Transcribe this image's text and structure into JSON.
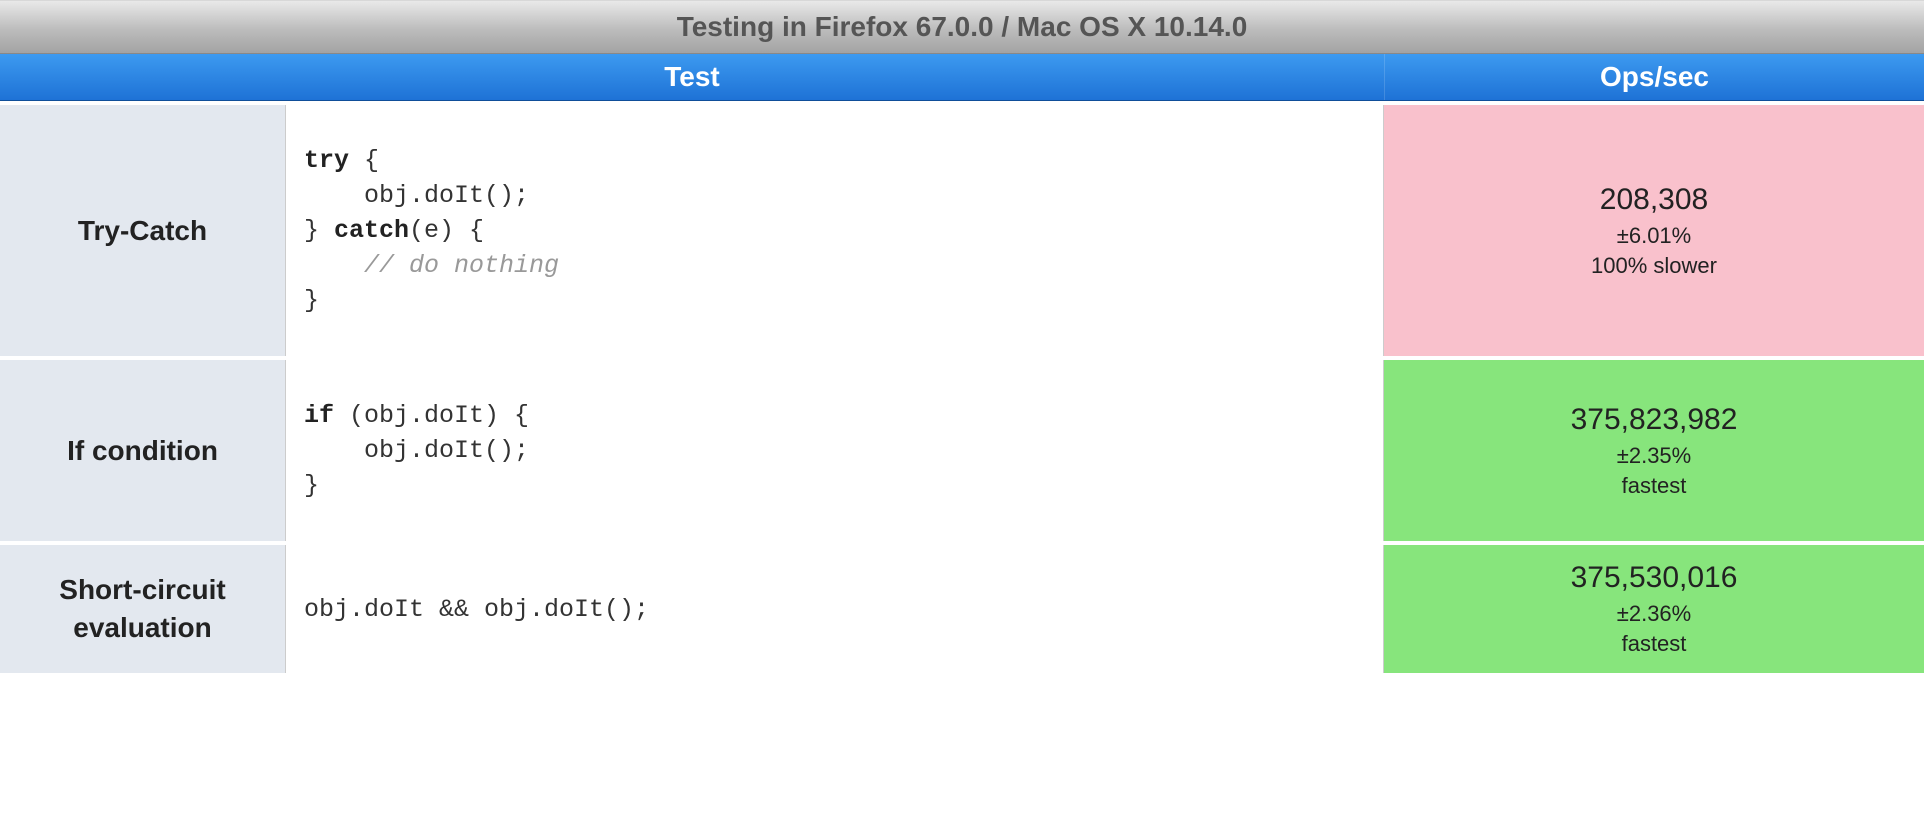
{
  "title": "Testing in Firefox 67.0.0 / Mac OS X 10.14.0",
  "headers": {
    "test": "Test",
    "ops": "Ops/sec"
  },
  "rows": [
    {
      "name": "Try-Catch",
      "code_html": "<span class=\"kw\">try</span> {\n    obj.doIt();\n} <span class=\"kw\">catch</span>(e) {\n    <span class=\"cmt\">// do nothing</span>\n}",
      "ops": "208,308",
      "dev": "±6.01%",
      "rank": "100% slower",
      "class": "slow"
    },
    {
      "name": "If condition",
      "code_html": "<span class=\"kw\">if</span> (obj.doIt) {\n    obj.doIt();\n}",
      "ops": "375,823,982",
      "dev": "±2.35%",
      "rank": "fastest",
      "class": "fast"
    },
    {
      "name": "Short-circuit evaluation",
      "code_html": "obj.doIt && obj.doIt();",
      "ops": "375,530,016",
      "dev": "±2.36%",
      "rank": "fastest",
      "class": "fast"
    }
  ]
}
